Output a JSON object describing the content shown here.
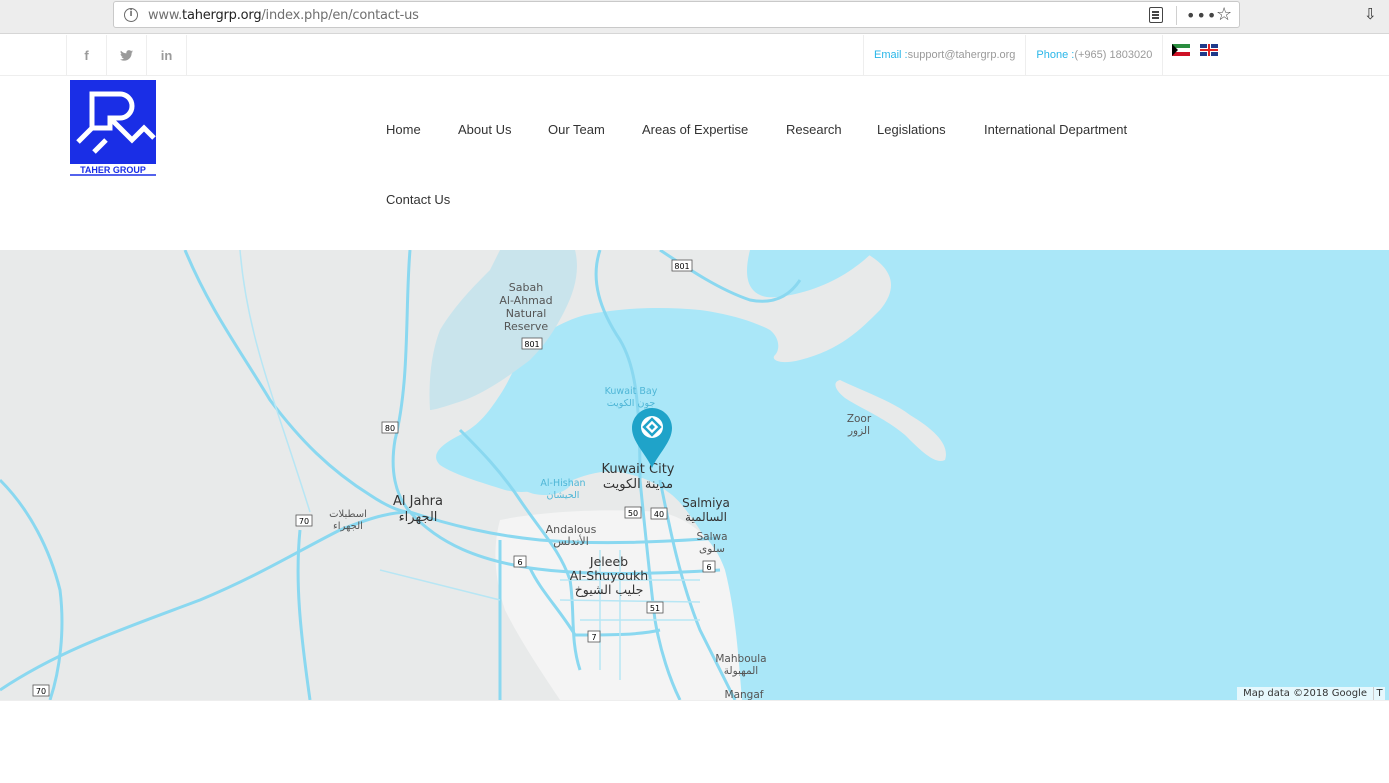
{
  "browser": {
    "url_prefix": "www.",
    "url_domain": "tahergrp.org",
    "url_path": "/index.php/en/contact-us"
  },
  "topbar": {
    "social": [
      {
        "name": "facebook",
        "glyph": "f"
      },
      {
        "name": "twitter",
        "glyph": "t"
      },
      {
        "name": "linkedin",
        "glyph": "in"
      }
    ],
    "email_label": "Email : ",
    "email_value": "support@tahergrp.org",
    "phone_label": "Phone : ",
    "phone_value": "(+965) 1803020",
    "flags": [
      "kuwait-flag-icon",
      "uk-flag-icon"
    ]
  },
  "logo": {
    "text": "TAHER GROUP",
    "color": "#1a2ee6"
  },
  "nav": {
    "items": [
      {
        "label": "Home"
      },
      {
        "label": "About Us"
      },
      {
        "label": "Our Team"
      },
      {
        "label": "Areas of Expertise"
      },
      {
        "label": "Research"
      },
      {
        "label": "Legislations"
      },
      {
        "label": "International Department"
      },
      {
        "label": "Contact Us"
      }
    ]
  },
  "map": {
    "water_color": "#aae7f8",
    "land_color": "#e8eaea",
    "road_color": "#8ad8f0",
    "marker_color": "#1fa3c9",
    "labels": {
      "sabah": [
        "Sabah",
        "Al-Ahmad",
        "Natural",
        "Reserve"
      ],
      "kuwait_bay_en": "Kuwait Bay",
      "kuwait_bay_ar": "جون الكويت",
      "zoor_en": "Zoor",
      "zoor_ar": "الزور",
      "kuwait_city_en": "Kuwait City",
      "kuwait_city_ar": "مدينة الكويت",
      "al_hishan_en": "Al-Hishan",
      "al_hishan_ar": "الحيشان",
      "al_jahra_en": "Al Jahra",
      "al_jahra_ar": "الجهراء",
      "istablat_ar1": "اسطبلات",
      "istablat_ar2": "الجهراء",
      "andalous_en": "Andalous",
      "andalous_ar": "الأندلس",
      "salmiya_en": "Salmiya",
      "salmiya_ar": "السالمية",
      "salwa_en": "Salwa",
      "salwa_ar": "سلوى",
      "jeleeb_en1": "Jeleeb",
      "jeleeb_en2": "Al-Shuyoukh",
      "jeleeb_ar": "جليب الشيوخ",
      "mahboula_en": "Mahboula",
      "mahboula_ar": "المهبولة",
      "mangaf_en": "Mangaf"
    },
    "route_shields": [
      "801",
      "801",
      "80",
      "70",
      "70",
      "50",
      "40",
      "6",
      "6",
      "51",
      "7"
    ],
    "credit": "Map data ©2018 Google",
    "credit_terms": "T"
  }
}
